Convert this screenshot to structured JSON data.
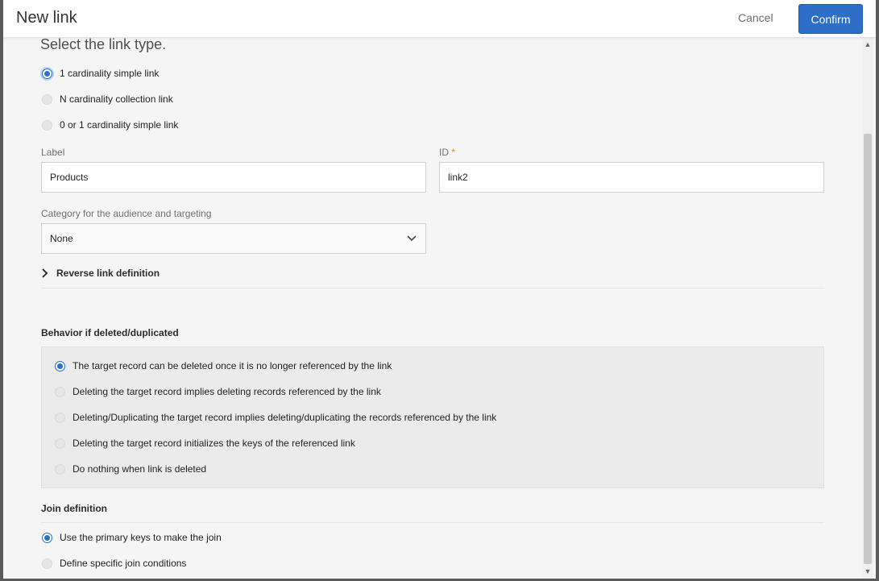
{
  "header": {
    "title": "New link",
    "cancel_label": "Cancel",
    "confirm_label": "Confirm"
  },
  "link_type": {
    "heading": "Select the link type.",
    "options": [
      {
        "label": "1 cardinality simple link",
        "selected": true
      },
      {
        "label": "N cardinality collection link",
        "selected": false
      },
      {
        "label": "0 or 1 cardinality simple link",
        "selected": false
      }
    ]
  },
  "fields": {
    "label_caption": "Label",
    "label_value": "Products",
    "id_caption": "ID",
    "id_required_mark": "*",
    "id_value": "link2",
    "category_caption": "Category for the audience and targeting",
    "category_value": "None"
  },
  "reverse_link": {
    "label": "Reverse link definition"
  },
  "behavior": {
    "heading": "Behavior if deleted/duplicated",
    "options": [
      {
        "label": "The target record can be deleted once it is no longer referenced by the link",
        "selected": true
      },
      {
        "label": "Deleting the target record implies deleting records referenced by the link",
        "selected": false
      },
      {
        "label": "Deleting/Duplicating the target record implies deleting/duplicating the records referenced by the link",
        "selected": false
      },
      {
        "label": "Deleting the target record initializes the keys of the referenced link",
        "selected": false
      },
      {
        "label": "Do nothing when link is deleted",
        "selected": false
      }
    ]
  },
  "join": {
    "heading": "Join definition",
    "options": [
      {
        "label": "Use the primary keys to make the join",
        "selected": true
      },
      {
        "label": "Define specific join conditions",
        "selected": false
      }
    ]
  },
  "colors": {
    "accent": "#2d6fc8",
    "required": "#e68619"
  }
}
